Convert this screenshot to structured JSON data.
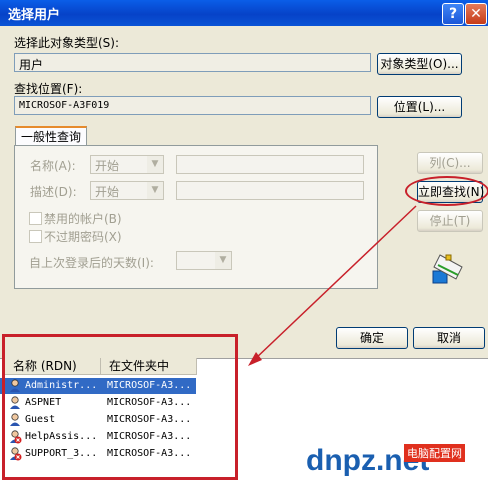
{
  "window": {
    "title": "选择用户",
    "help_glyph": "?",
    "close_glyph": "✕"
  },
  "object_type": {
    "label": "选择此对象类型(S):",
    "value": "用户",
    "button": "对象类型(O)..."
  },
  "location": {
    "label": "查找位置(F):",
    "value": "MICROSOF-A3F019",
    "button": "位置(L)..."
  },
  "tab": {
    "label": "一般性查询"
  },
  "query": {
    "name_label": "名称(A):",
    "name_op": "开始",
    "desc_label": "描述(D):",
    "desc_op": "开始",
    "disabled_accounts": "禁用的帐户(B)",
    "no_expire_pwd": "不过期密码(X)",
    "days_since_login": "自上次登录后的天数(I):"
  },
  "side_buttons": {
    "columns": "列(C)...",
    "find_now": "立即查找(N)",
    "stop": "停止(T)"
  },
  "ok": "确定",
  "cancel": "取消",
  "results": {
    "col_name": "名称 (RDN)",
    "col_folder": "在文件夹中",
    "rows": [
      {
        "name": "Administr...",
        "folder": "MICROSOF-A3...",
        "selected": true,
        "icon": "user-icon"
      },
      {
        "name": "ASPNET",
        "folder": "MICROSOF-A3...",
        "selected": false,
        "icon": "user-icon"
      },
      {
        "name": "Guest",
        "folder": "MICROSOF-A3...",
        "selected": false,
        "icon": "user-icon"
      },
      {
        "name": "HelpAssis...",
        "folder": "MICROSOF-A3...",
        "selected": false,
        "icon": "disabled-user-icon"
      },
      {
        "name": "SUPPORT_3...",
        "folder": "MICROSOF-A3...",
        "selected": false,
        "icon": "disabled-user-icon"
      }
    ]
  },
  "watermark": {
    "text": "dnpz.net",
    "subtitle": "电脑配置网"
  },
  "colors": {
    "accent": "#316ac5",
    "annotation": "#c8202a"
  }
}
